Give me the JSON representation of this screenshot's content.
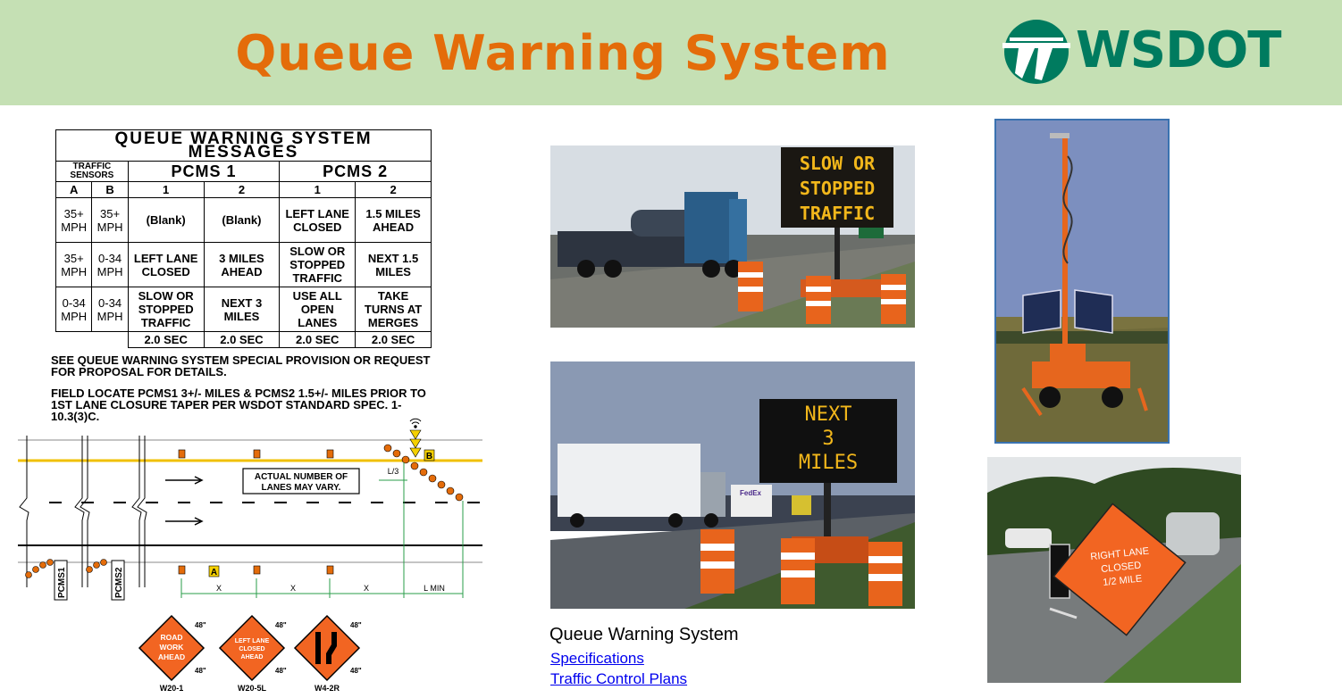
{
  "header": {
    "title": "Queue Warning System",
    "logo_text": "WSDOT",
    "title_color": "#e46c0a",
    "band_color": "#c5e0b4",
    "logo_color": "#007b5f"
  },
  "message_table": {
    "title": "QUEUE WARNING SYSTEM MESSAGES",
    "sensors_label": "TRAFFIC SENSORS",
    "pcms1_label": "PCMS 1",
    "pcms2_label": "PCMS 2",
    "col_a": "A",
    "col_b": "B",
    "col_1a": "1",
    "col_2a": "2",
    "col_1b": "1",
    "col_2b": "2",
    "rows": [
      {
        "a": "35+ MPH",
        "b": "35+ MPH",
        "p1_1": "(Blank)",
        "p1_2": "(Blank)",
        "p2_1": "LEFT LANE CLOSED",
        "p2_2": "1.5 MILES AHEAD"
      },
      {
        "a": "35+ MPH",
        "b": "0-34 MPH",
        "p1_1": "LEFT LANE CLOSED",
        "p1_2": "3 MILES AHEAD",
        "p2_1": "SLOW OR STOPPED TRAFFIC",
        "p2_2": "NEXT 1.5 MILES"
      },
      {
        "a": "0-34 MPH",
        "b": "0-34 MPH",
        "p1_1": "SLOW OR STOPPED TRAFFIC",
        "p1_2": "NEXT 3 MILES",
        "p2_1": "USE ALL OPEN LANES",
        "p2_2": "TAKE TURNS AT MERGES"
      }
    ],
    "durations": [
      "2.0 SEC",
      "2.0 SEC",
      "2.0 SEC",
      "2.0 SEC"
    ]
  },
  "notes": [
    "SEE QUEUE WARNING SYSTEM SPECIAL PROVISION OR REQUEST FOR PROPOSAL FOR DETAILS.",
    "FIELD LOCATE PCMS1 3+/- MILES & PCMS2 1.5+/- MILES PRIOR TO 1ST LANE CLOSURE TAPER PER WSDOT STANDARD SPEC. 1-10.3(3)C."
  ],
  "diagram": {
    "lanes_note_1": "ACTUAL NUMBER OF",
    "lanes_note_2": "LANES MAY VARY.",
    "pcms1": "PCMS1",
    "pcms2": "PCMS2",
    "sensor_a": "A",
    "sensor_b": "B",
    "taper": "L/3",
    "dist_x1": "X",
    "dist_x2": "X",
    "dist_x3": "X",
    "dist_lmin": "L MIN",
    "signs": [
      {
        "code": "W20-1",
        "size_top": "48\"",
        "size_bottom": "48\"",
        "lines": [
          "ROAD",
          "WORK",
          "AHEAD"
        ]
      },
      {
        "code": "W20-5L",
        "size_top": "48\"",
        "size_bottom": "48\"",
        "lines": [
          "LEFT LANE",
          "CLOSED",
          "AHEAD"
        ]
      },
      {
        "code": "W4-2R",
        "size_top": "48\"",
        "size_bottom": "48\"",
        "lines": []
      }
    ]
  },
  "photos": {
    "sign1_lines": [
      "SLOW OR",
      "STOPPED",
      "TRAFFIC"
    ],
    "sign2_lines": [
      "NEXT",
      "3",
      "MILES"
    ],
    "sign3_lines": [
      "RIGHT LANE",
      "CLOSED",
      "1/2 MILE"
    ],
    "truck_logo": "FedEx"
  },
  "links": {
    "caption": "Queue Warning System",
    "specifications": "Specifications",
    "traffic_control_plans": "Traffic Control Plans"
  }
}
